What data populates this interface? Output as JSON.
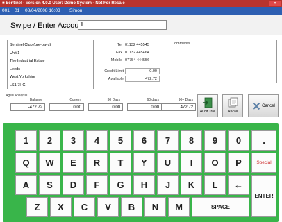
{
  "title_bar": {
    "text": "■ Sentinel - Version 4.0.0      User: Demo System - Not For Resale",
    "close_label": "✕"
  },
  "status_bar": {
    "terminal": "001",
    "station": "01",
    "datetime": "08/04/2008  16:03",
    "user": "Simon"
  },
  "swipe": {
    "label": "Swipe / Enter Account",
    "value": "1"
  },
  "address": [
    "Sentinel Club (pre-pays)",
    "Unit 1",
    "The Industrial Estate",
    "Leeds",
    "West Yorkshire",
    "LS1 7HG"
  ],
  "contact": {
    "tel_label": "Tel",
    "tel": "01132 445545",
    "fax_label": "Fax",
    "fax": "01132 445464",
    "mobile_label": "Mobile",
    "mobile": "07754 444556",
    "credit_label": "Credit Limit",
    "credit": "0.00",
    "available_label": "Available",
    "available": "472.72"
  },
  "comments_label": "Comments",
  "aged": {
    "title": "Aged Analysis",
    "columns": [
      {
        "header": "Balance",
        "value": "-472.72"
      },
      {
        "header": "Current",
        "value": "0.00"
      },
      {
        "header": "30 Days",
        "value": "0.00"
      },
      {
        "header": "60 days",
        "value": "0.00"
      },
      {
        "header": "90+ Days",
        "value": "472.72"
      }
    ]
  },
  "actions": {
    "audit": "Audit Trail",
    "recall": "Recall",
    "cancel": "Cancel"
  },
  "keyboard": {
    "row1": [
      "1",
      "2",
      "3",
      "4",
      "5",
      "6",
      "7",
      "8",
      "9",
      "0",
      "."
    ],
    "row2": [
      "Q",
      "W",
      "E",
      "R",
      "T",
      "Y",
      "U",
      "I",
      "O",
      "P"
    ],
    "special": "Special",
    "row3": [
      "A",
      "S",
      "D",
      "F",
      "G",
      "H",
      "J",
      "K",
      "L"
    ],
    "backspace": "←",
    "enter": "ENTER",
    "row4": [
      "Z",
      "X",
      "C",
      "V",
      "B",
      "N",
      "M"
    ],
    "space": "SPACE"
  },
  "colors": {
    "title_bar": "#b8342e",
    "status_bar": "#2d5fb2",
    "keyboard_bg": "#39b54a",
    "special_text": "#cc2a2a"
  }
}
